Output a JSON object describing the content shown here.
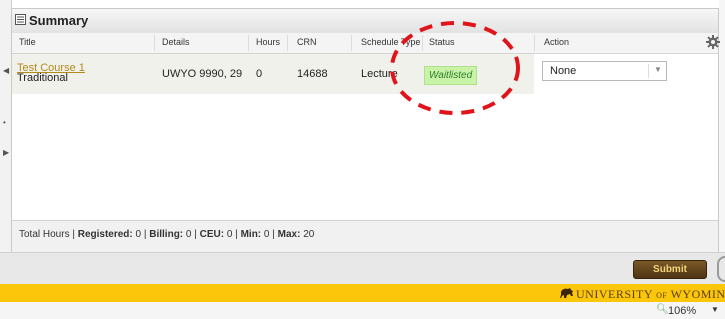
{
  "panel": {
    "title": "Summary"
  },
  "columns": {
    "title": "Title",
    "details": "Details",
    "hours": "Hours",
    "crn": "CRN",
    "schedule_type": "Schedule Type",
    "status": "Status",
    "action": "Action"
  },
  "row": {
    "course_title": "Test Course 1",
    "course_type": "Traditional",
    "details": "UWYO 9990, 29",
    "hours": "0",
    "crn": "14688",
    "schedule_type": "Lecture",
    "status": "Waitlisted",
    "action": "None"
  },
  "totals": {
    "label": "Total Hours",
    "registered_label": "Registered:",
    "registered": "0",
    "billing_label": "Billing:",
    "billing": "0",
    "ceu_label": "CEU:",
    "ceu": "0",
    "min_label": "Min:",
    "min": "0",
    "max_label": "Max:",
    "max": "20"
  },
  "submit_label": "Submit",
  "brand": {
    "university": "UNIVERSITY",
    "of": "OF",
    "wyoming": "WYOMING"
  },
  "zoom": "106%",
  "colors": {
    "accent_gold": "#fcc70b",
    "brown": "#5a3d10",
    "status_bg": "#c9f3a7",
    "annotation_red": "#e0151b"
  },
  "icons": [
    "summary-icon",
    "gear-icon",
    "chevron-down-icon",
    "bison-icon",
    "zoom-icon"
  ]
}
